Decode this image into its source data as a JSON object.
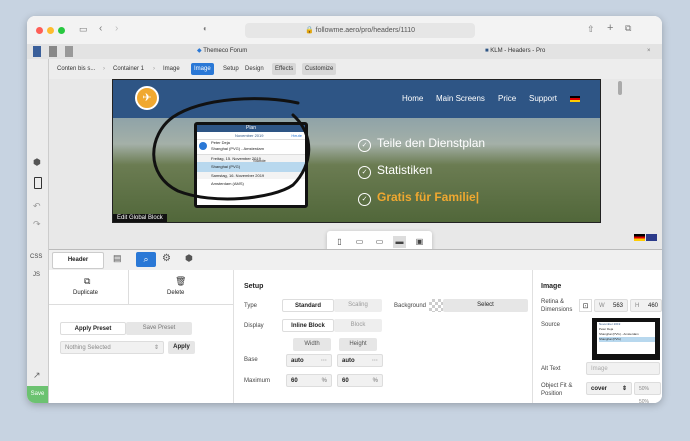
{
  "browser": {
    "url": "followme.aero/pro/headers/1110",
    "tab1": "Themeco Forum",
    "tab2": "KLM - Headers - Pro"
  },
  "toolbar": {
    "crumbs": [
      "Conten bis s...",
      "Container 1",
      "Image"
    ],
    "tabs": [
      "Image",
      "Setup",
      "Design",
      "Effects",
      "Customize"
    ]
  },
  "rail": {
    "css": "CSS",
    "js": "JS",
    "save": "Save"
  },
  "site": {
    "nav": [
      "Home",
      "Main Screens",
      "Price",
      "Support"
    ],
    "features": [
      "Teile den Dienstplan",
      "Statistiken",
      "Gratis für Familie|"
    ],
    "edit_global": "Edit Global Block"
  },
  "phone": {
    "header": "Plan",
    "month": "November 2019",
    "today": "Heute",
    "rows": [
      "Peter Deja",
      "Shanghai (PVG) - Amsterdam",
      "Freitag, 15. November 2019",
      "Shanghai (PVG)",
      "Samstag, 16. November 2019",
      "Amsterdam (AMS)"
    ],
    "time": "Stunde"
  },
  "panel": {
    "tab_header": "Header",
    "duplicate": "Duplicate",
    "delete": "Delete",
    "apply_preset": "Apply Preset",
    "save_preset": "Save Preset",
    "nothing_selected": "Nothing Selected",
    "apply": "Apply",
    "setup_title": "Setup",
    "type_label": "Type",
    "type_standard": "Standard",
    "type_scaling": "Scaling",
    "display_label": "Display",
    "display_inline": "Inline Block",
    "display_block": "Block",
    "width_label": "Width",
    "height_label": "Height",
    "base_label": "Base",
    "maximum_label": "Maximum",
    "base_w": "auto",
    "base_h": "auto",
    "max_w": "60",
    "max_h": "60",
    "pct": "%",
    "dots": "···",
    "background_label": "Background",
    "select": "Select",
    "image_title": "Image",
    "retina_label": "Retina & Dimensions",
    "w_label": "W",
    "w_val": "563",
    "h_label": "H",
    "h_val": "460",
    "source_label": "Source",
    "alt_label": "Alt Text",
    "alt_placeholder": "Image",
    "fit_label": "Object Fit & Position",
    "fit_val": "cover",
    "pos_val": "50% 50%"
  },
  "colors": {
    "accent": "#2a78d6",
    "nav": "#2e5585",
    "gold": "#f0a830"
  }
}
